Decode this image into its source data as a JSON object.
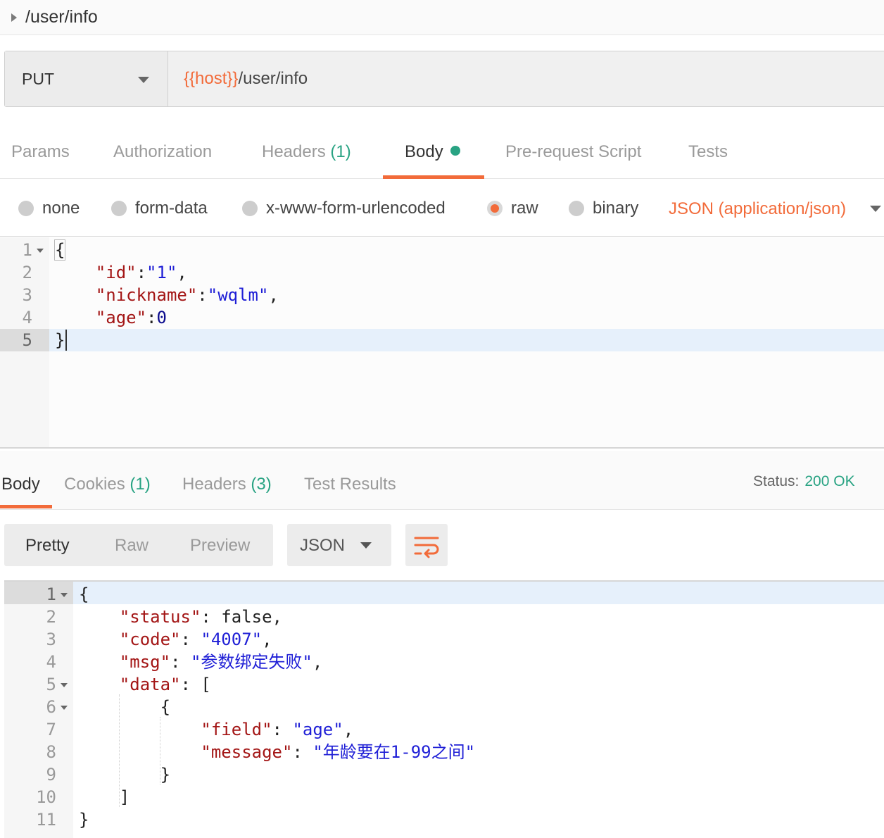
{
  "request": {
    "name": "/user/info",
    "method": "PUT",
    "url_var": "{{host}}",
    "url_path": "/user/info"
  },
  "request_tabs": {
    "params": "Params",
    "authorization": "Authorization",
    "headers": "Headers",
    "headers_count": "(1)",
    "body": "Body",
    "prerequest": "Pre-request Script",
    "tests": "Tests",
    "active": "Body"
  },
  "body_types": {
    "none": "none",
    "form_data": "form-data",
    "urlencoded": "x-www-form-urlencoded",
    "raw": "raw",
    "binary": "binary",
    "selected": "raw",
    "content_type": "JSON (application/json)"
  },
  "request_body": {
    "line_numbers": [
      "1",
      "2",
      "3",
      "4",
      "5"
    ],
    "lines": [
      {
        "parts": [
          {
            "t": "p",
            "v": "{"
          }
        ]
      },
      {
        "parts": [
          {
            "t": "p",
            "v": "    "
          },
          {
            "t": "k",
            "v": "\"id\""
          },
          {
            "t": "p",
            "v": ":"
          },
          {
            "t": "s",
            "v": "\"1\""
          },
          {
            "t": "p",
            "v": ","
          }
        ]
      },
      {
        "parts": [
          {
            "t": "p",
            "v": "    "
          },
          {
            "t": "k",
            "v": "\"nickname\""
          },
          {
            "t": "p",
            "v": ":"
          },
          {
            "t": "s",
            "v": "\"wqlm\""
          },
          {
            "t": "p",
            "v": ","
          }
        ]
      },
      {
        "parts": [
          {
            "t": "p",
            "v": "    "
          },
          {
            "t": "k",
            "v": "\"age\""
          },
          {
            "t": "p",
            "v": ":"
          },
          {
            "t": "n",
            "v": "0"
          }
        ]
      },
      {
        "parts": [
          {
            "t": "p",
            "v": "}"
          }
        ]
      }
    ]
  },
  "response_tabs": {
    "body": "Body",
    "cookies": "Cookies",
    "cookies_count": "(1)",
    "headers": "Headers",
    "headers_count": "(3)",
    "test_results": "Test Results",
    "status_label": "Status:",
    "status_value": "200 OK"
  },
  "response_toolbar": {
    "pretty": "Pretty",
    "raw": "Raw",
    "preview": "Preview",
    "format": "JSON"
  },
  "response_body": {
    "line_numbers": [
      "1",
      "2",
      "3",
      "4",
      "5",
      "6",
      "7",
      "8",
      "9",
      "10",
      "11"
    ],
    "lines": [
      {
        "parts": [
          {
            "t": "p",
            "v": "{"
          }
        ]
      },
      {
        "parts": [
          {
            "t": "p",
            "v": "    "
          },
          {
            "t": "k",
            "v": "\"status\""
          },
          {
            "t": "p",
            "v": ": false,"
          }
        ]
      },
      {
        "parts": [
          {
            "t": "p",
            "v": "    "
          },
          {
            "t": "k",
            "v": "\"code\""
          },
          {
            "t": "p",
            "v": ": "
          },
          {
            "t": "s",
            "v": "\"4007\""
          },
          {
            "t": "p",
            "v": ","
          }
        ]
      },
      {
        "parts": [
          {
            "t": "p",
            "v": "    "
          },
          {
            "t": "k",
            "v": "\"msg\""
          },
          {
            "t": "p",
            "v": ": "
          },
          {
            "t": "s",
            "v": "\"参数绑定失败\""
          },
          {
            "t": "p",
            "v": ","
          }
        ]
      },
      {
        "parts": [
          {
            "t": "p",
            "v": "    "
          },
          {
            "t": "k",
            "v": "\"data\""
          },
          {
            "t": "p",
            "v": ": ["
          }
        ]
      },
      {
        "parts": [
          {
            "t": "p",
            "v": "        {"
          }
        ]
      },
      {
        "parts": [
          {
            "t": "p",
            "v": "            "
          },
          {
            "t": "k",
            "v": "\"field\""
          },
          {
            "t": "p",
            "v": ": "
          },
          {
            "t": "s",
            "v": "\"age\""
          },
          {
            "t": "p",
            "v": ","
          }
        ]
      },
      {
        "parts": [
          {
            "t": "p",
            "v": "            "
          },
          {
            "t": "k",
            "v": "\"message\""
          },
          {
            "t": "p",
            "v": ": "
          },
          {
            "t": "s",
            "v": "\"年龄要在1-99之间\""
          }
        ]
      },
      {
        "parts": [
          {
            "t": "p",
            "v": "        }"
          }
        ]
      },
      {
        "parts": [
          {
            "t": "p",
            "v": "    ]"
          }
        ]
      },
      {
        "parts": [
          {
            "t": "p",
            "v": "}"
          }
        ]
      }
    ]
  },
  "icons": {
    "collapse": "caret-right-icon",
    "method_dropdown": "chevron-down-icon",
    "wrap": "wrap-lines-icon"
  },
  "colors": {
    "accent": "#f26b3a",
    "success": "#29a383"
  }
}
